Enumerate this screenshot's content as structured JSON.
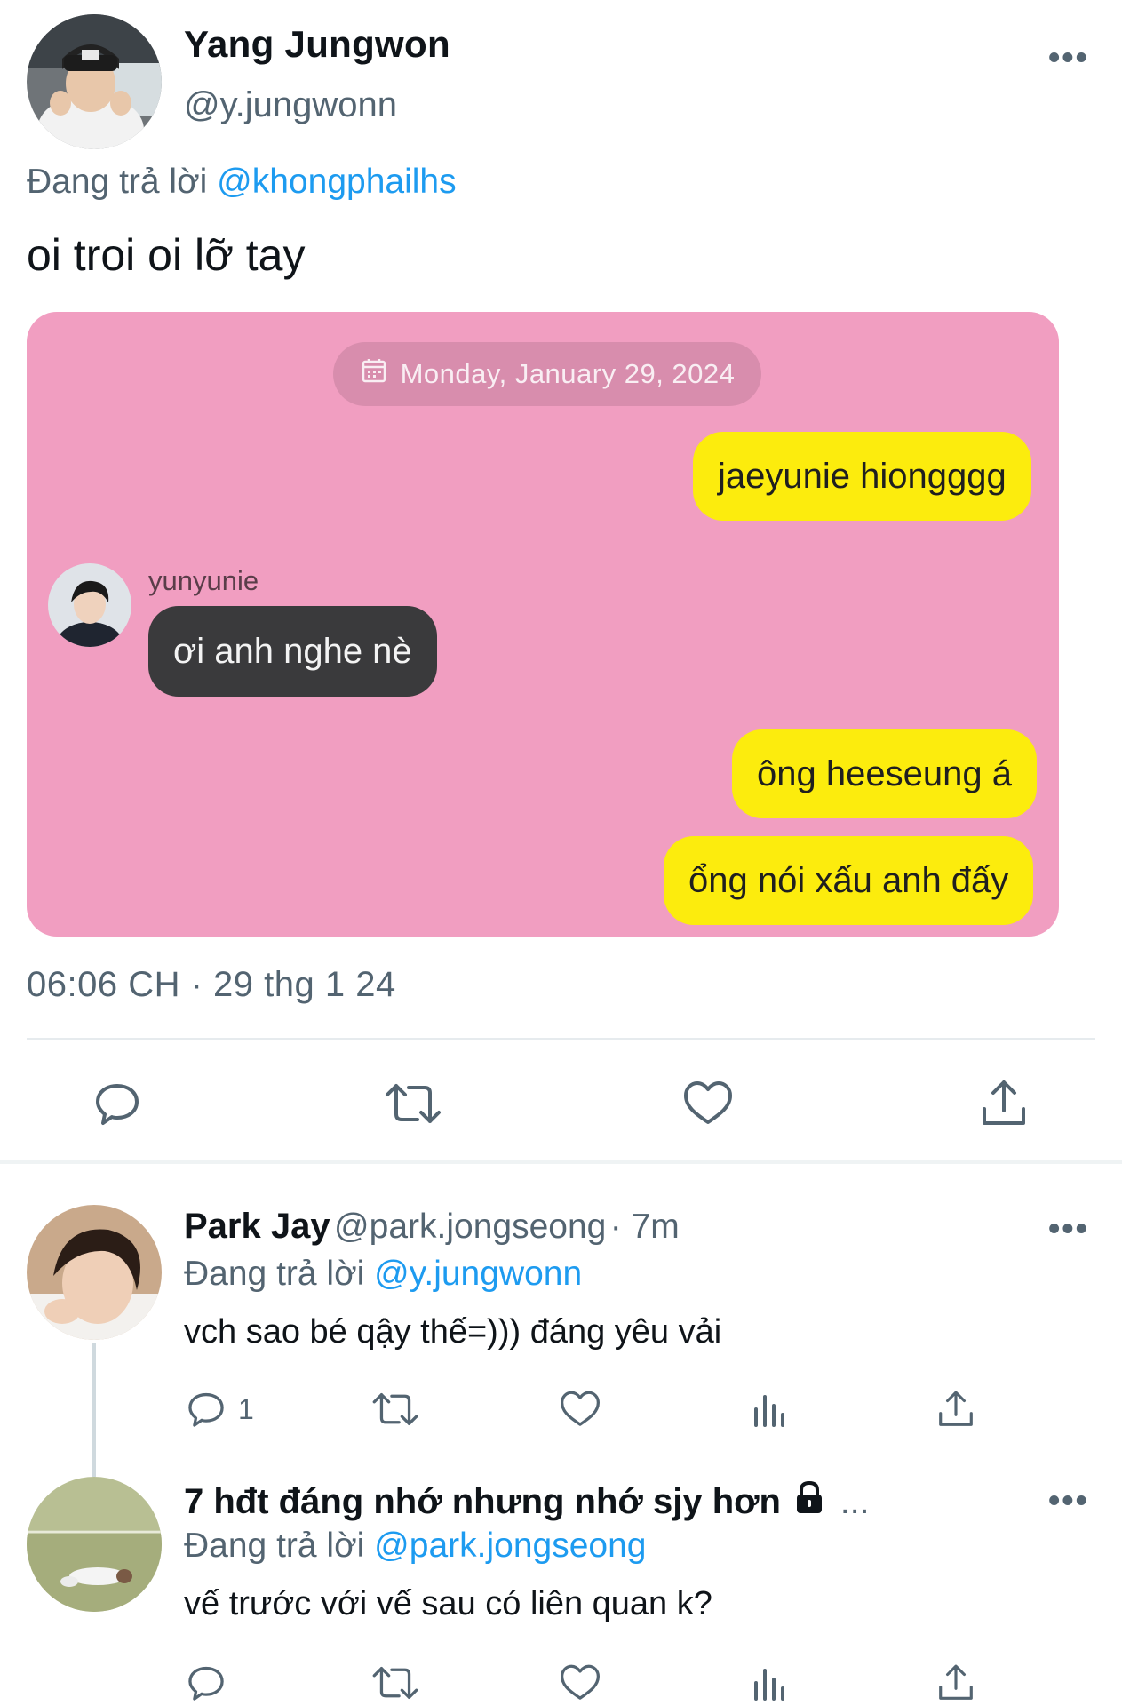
{
  "main_tweet": {
    "author_name": "Yang Jungwon",
    "author_handle": "@y.jungwonn",
    "more_label": "•••",
    "replying_prefix": "Đang trả lời",
    "replying_to": "@khongphailhs",
    "text": "oi troi oi lỡ tay",
    "timestamp": "06:06 CH · 29 thg 1 24"
  },
  "chat_image": {
    "date": "Monday, January 29, 2024",
    "sender_name": "yunyunie",
    "messages": [
      {
        "from": "me",
        "text": "jaeyunie hiongggg"
      },
      {
        "from": "them",
        "text": "ơi anh nghe nè"
      },
      {
        "from": "me",
        "text": "ông heeseung á"
      },
      {
        "from": "me",
        "text": "ổng nói xấu anh đấy"
      }
    ]
  },
  "actions": {
    "icons": [
      "reply-icon",
      "retweet-icon",
      "like-icon",
      "share-icon"
    ]
  },
  "replies": [
    {
      "name": "Park Jay",
      "handle": "@park.jongseong",
      "time": "· 7m",
      "replying_prefix": "Đang trả lời",
      "replying_to": "@y.jungwonn",
      "text": "vch sao bé qậy thế=))) đáng yêu vải",
      "reply_count": "1",
      "more_label": "•••"
    },
    {
      "name": "7 hđt đáng nhớ nhưng nhớ sjy hơn",
      "name_suffix": "...",
      "replying_prefix": "Đang trả lời",
      "replying_to": "@park.jongseong",
      "text": "vế trước với vế sau có liên quan k?",
      "more_label": "•••"
    }
  ],
  "colors": {
    "link": "#1d9bf0",
    "muted": "#536471",
    "chat_background": "#f19ec1",
    "my_bubble": "#fcec0d",
    "their_bubble": "#3a3a3c"
  }
}
